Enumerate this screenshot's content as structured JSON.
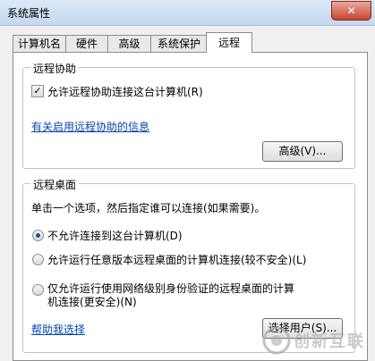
{
  "window": {
    "title": "系统属性",
    "close_label": "✕"
  },
  "tabs": [
    {
      "label": "计算机名"
    },
    {
      "label": "硬件"
    },
    {
      "label": "高级"
    },
    {
      "label": "系统保护"
    },
    {
      "label": "远程",
      "active": true
    }
  ],
  "remote_assistance": {
    "group_title": "远程协助",
    "checkbox_label": "允许远程协助连接这台计算机(R)",
    "checkbox_checked": true,
    "info_link": "有关启用远程协助的信息",
    "advanced_button": "高级(V)..."
  },
  "remote_desktop": {
    "group_title": "远程桌面",
    "instruction": "单击一个选项，然后指定谁可以连接(如果需要)。",
    "options": [
      {
        "label": "不允许连接到这台计算机(D)",
        "selected": true
      },
      {
        "label": "允许运行任意版本远程桌面的计算机连接(较不安全)(L)",
        "selected": false
      },
      {
        "label_line1": "仅允许运行使用网络级别身份验证的远程桌面的计算",
        "label_line2": "机连接(更安全)(N)",
        "selected": false
      }
    ],
    "help_link": "帮助我选择",
    "select_users_button": "选择用户(S)..."
  },
  "watermark": {
    "text": "创新互联"
  }
}
